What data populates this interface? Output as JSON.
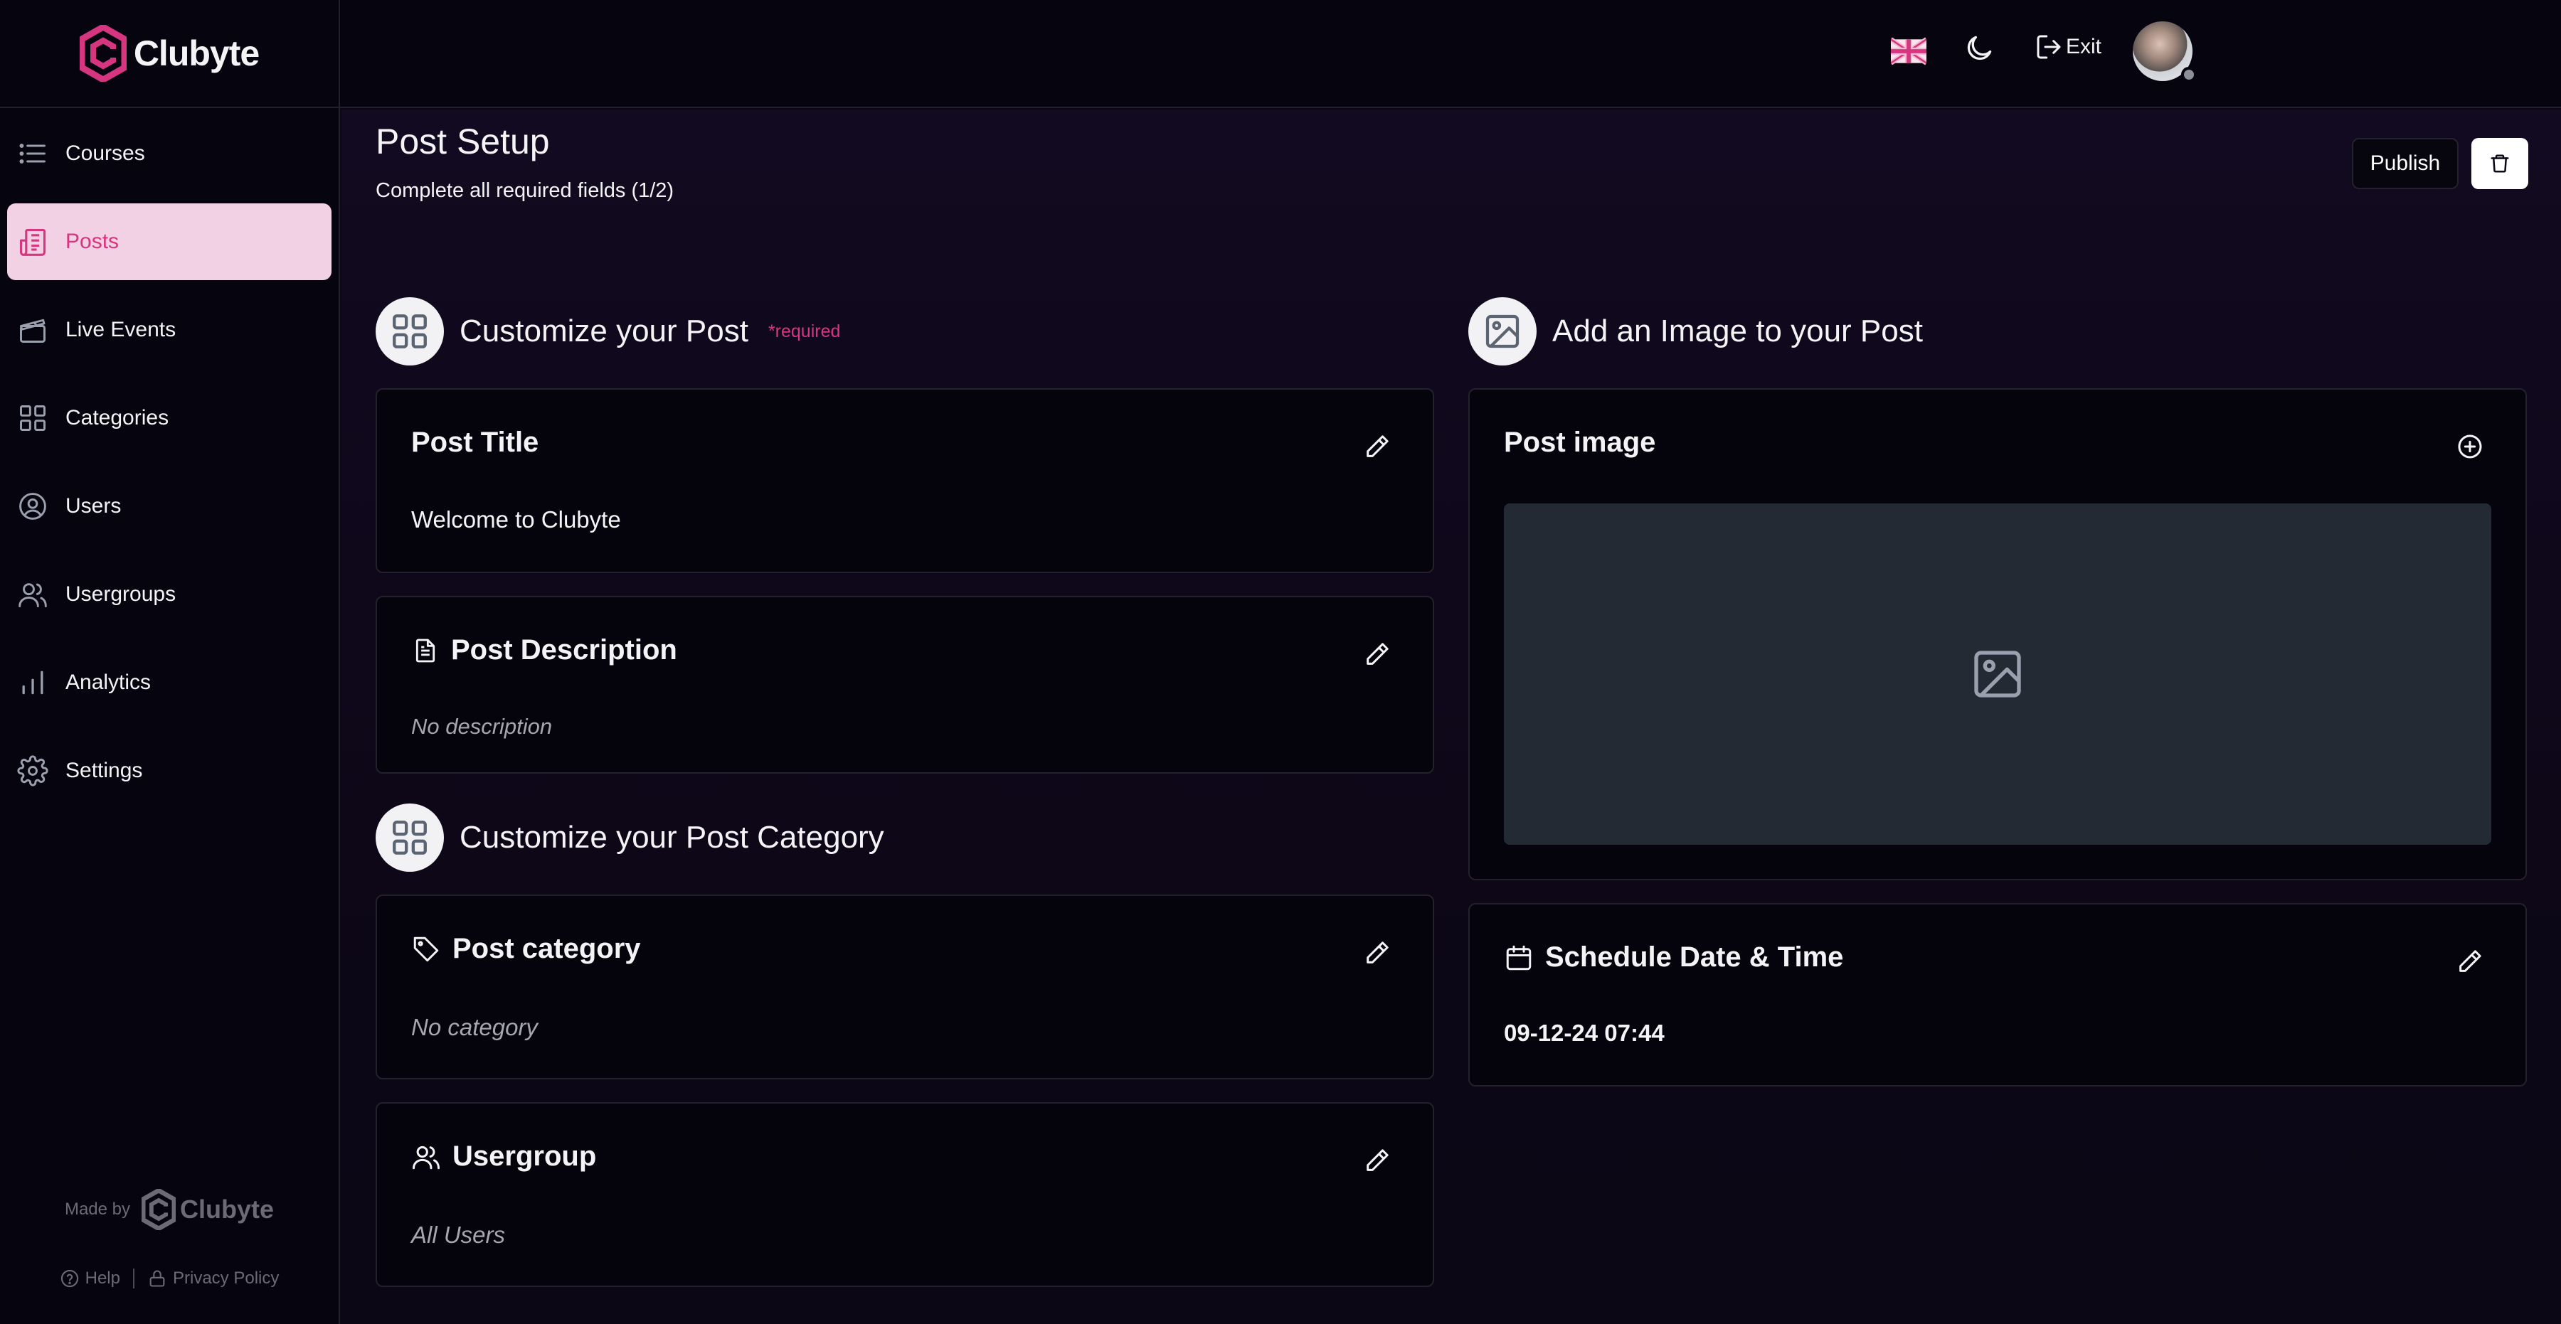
{
  "brand": {
    "name": "Clubyte",
    "accent": "#d6367f"
  },
  "sidebar": {
    "items": [
      {
        "label": "Courses",
        "icon": "list-icon",
        "active": false
      },
      {
        "label": "Posts",
        "icon": "newspaper-icon",
        "active": true
      },
      {
        "label": "Live Events",
        "icon": "clapperboard-icon",
        "active": false
      },
      {
        "label": "Categories",
        "icon": "grid-icon",
        "active": false
      },
      {
        "label": "Users",
        "icon": "user-circle-icon",
        "active": false
      },
      {
        "label": "Usergroups",
        "icon": "users-icon",
        "active": false
      },
      {
        "label": "Analytics",
        "icon": "bar-chart-icon",
        "active": false
      },
      {
        "label": "Settings",
        "icon": "gear-icon",
        "active": false
      }
    ],
    "footer": {
      "made_by": "Made by",
      "help": "Help",
      "privacy": "Privacy Policy"
    }
  },
  "topbar": {
    "exit_label": "Exit",
    "language": "en-GB"
  },
  "page": {
    "title": "Post Setup",
    "subtitle": "Complete all required fields (1/2)",
    "publish_label": "Publish"
  },
  "sections": {
    "customize_post": {
      "title": "Customize your Post",
      "required": "*required"
    },
    "add_image": {
      "title": "Add an Image to your Post"
    },
    "customize_category": {
      "title": "Customize your Post Category"
    }
  },
  "cards": {
    "post_title": {
      "title": "Post Title",
      "value": "Welcome to Clubyte"
    },
    "post_description": {
      "title": "Post Description",
      "value": "No description"
    },
    "post_category": {
      "title": "Post category",
      "value": "No category"
    },
    "usergroup": {
      "title": "Usergroup",
      "value": "All Users"
    },
    "post_image": {
      "title": "Post image"
    },
    "schedule": {
      "title": "Schedule Date & Time",
      "value": "09-12-24 07:44"
    }
  }
}
